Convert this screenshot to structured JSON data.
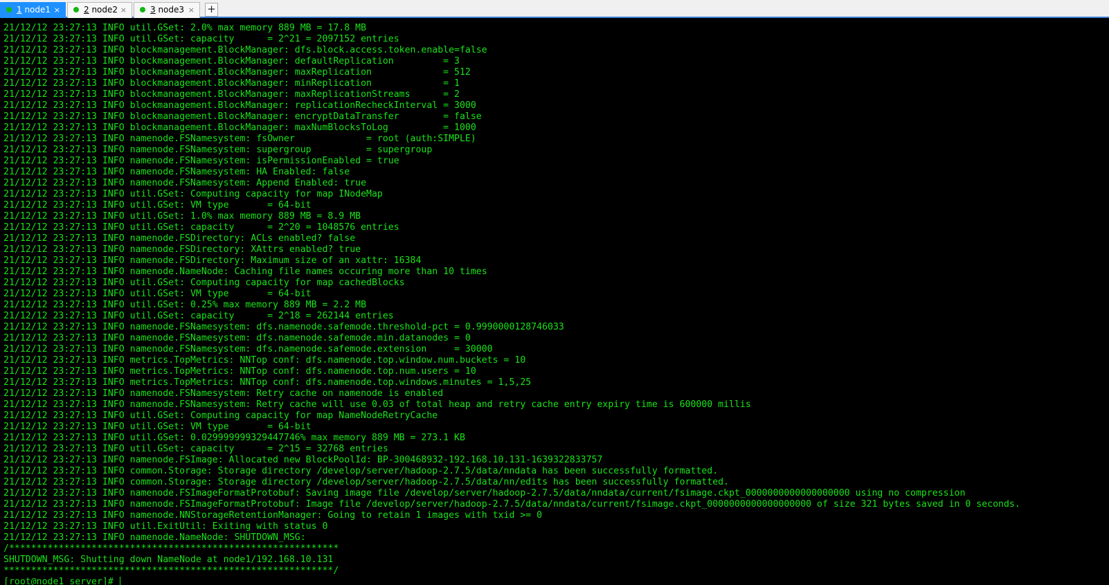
{
  "tabs": [
    {
      "num": "1",
      "label": " node1",
      "active": true
    },
    {
      "num": "2",
      "label": " node2",
      "active": false
    },
    {
      "num": "3",
      "label": " node3",
      "active": false
    }
  ],
  "add_tab_label": "+",
  "close_glyph": "×",
  "terminal": {
    "lines": [
      "21/12/12 23:27:13 INFO util.GSet: 2.0% max memory 889 MB = 17.8 MB",
      "21/12/12 23:27:13 INFO util.GSet: capacity      = 2^21 = 2097152 entries",
      "21/12/12 23:27:13 INFO blockmanagement.BlockManager: dfs.block.access.token.enable=false",
      "21/12/12 23:27:13 INFO blockmanagement.BlockManager: defaultReplication         = 3",
      "21/12/12 23:27:13 INFO blockmanagement.BlockManager: maxReplication             = 512",
      "21/12/12 23:27:13 INFO blockmanagement.BlockManager: minReplication             = 1",
      "21/12/12 23:27:13 INFO blockmanagement.BlockManager: maxReplicationStreams      = 2",
      "21/12/12 23:27:13 INFO blockmanagement.BlockManager: replicationRecheckInterval = 3000",
      "21/12/12 23:27:13 INFO blockmanagement.BlockManager: encryptDataTransfer        = false",
      "21/12/12 23:27:13 INFO blockmanagement.BlockManager: maxNumBlocksToLog          = 1000",
      "21/12/12 23:27:13 INFO namenode.FSNamesystem: fsOwner             = root (auth:SIMPLE)",
      "21/12/12 23:27:13 INFO namenode.FSNamesystem: supergroup          = supergroup",
      "21/12/12 23:27:13 INFO namenode.FSNamesystem: isPermissionEnabled = true",
      "21/12/12 23:27:13 INFO namenode.FSNamesystem: HA Enabled: false",
      "21/12/12 23:27:13 INFO namenode.FSNamesystem: Append Enabled: true",
      "21/12/12 23:27:13 INFO util.GSet: Computing capacity for map INodeMap",
      "21/12/12 23:27:13 INFO util.GSet: VM type       = 64-bit",
      "21/12/12 23:27:13 INFO util.GSet: 1.0% max memory 889 MB = 8.9 MB",
      "21/12/12 23:27:13 INFO util.GSet: capacity      = 2^20 = 1048576 entries",
      "21/12/12 23:27:13 INFO namenode.FSDirectory: ACLs enabled? false",
      "21/12/12 23:27:13 INFO namenode.FSDirectory: XAttrs enabled? true",
      "21/12/12 23:27:13 INFO namenode.FSDirectory: Maximum size of an xattr: 16384",
      "21/12/12 23:27:13 INFO namenode.NameNode: Caching file names occuring more than 10 times",
      "21/12/12 23:27:13 INFO util.GSet: Computing capacity for map cachedBlocks",
      "21/12/12 23:27:13 INFO util.GSet: VM type       = 64-bit",
      "21/12/12 23:27:13 INFO util.GSet: 0.25% max memory 889 MB = 2.2 MB",
      "21/12/12 23:27:13 INFO util.GSet: capacity      = 2^18 = 262144 entries",
      "21/12/12 23:27:13 INFO namenode.FSNamesystem: dfs.namenode.safemode.threshold-pct = 0.9990000128746033",
      "21/12/12 23:27:13 INFO namenode.FSNamesystem: dfs.namenode.safemode.min.datanodes = 0",
      "21/12/12 23:27:13 INFO namenode.FSNamesystem: dfs.namenode.safemode.extension     = 30000",
      "21/12/12 23:27:13 INFO metrics.TopMetrics: NNTop conf: dfs.namenode.top.window.num.buckets = 10",
      "21/12/12 23:27:13 INFO metrics.TopMetrics: NNTop conf: dfs.namenode.top.num.users = 10",
      "21/12/12 23:27:13 INFO metrics.TopMetrics: NNTop conf: dfs.namenode.top.windows.minutes = 1,5,25",
      "21/12/12 23:27:13 INFO namenode.FSNamesystem: Retry cache on namenode is enabled",
      "21/12/12 23:27:13 INFO namenode.FSNamesystem: Retry cache will use 0.03 of total heap and retry cache entry expiry time is 600000 millis",
      "21/12/12 23:27:13 INFO util.GSet: Computing capacity for map NameNodeRetryCache",
      "21/12/12 23:27:13 INFO util.GSet: VM type       = 64-bit",
      "21/12/12 23:27:13 INFO util.GSet: 0.029999999329447746% max memory 889 MB = 273.1 KB",
      "21/12/12 23:27:13 INFO util.GSet: capacity      = 2^15 = 32768 entries",
      "21/12/12 23:27:13 INFO namenode.FSImage: Allocated new BlockPoolId: BP-300468932-192.168.10.131-1639322833757",
      "21/12/12 23:27:13 INFO common.Storage: Storage directory /develop/server/hadoop-2.7.5/data/nndata has been successfully formatted.",
      "21/12/12 23:27:13 INFO common.Storage: Storage directory /develop/server/hadoop-2.7.5/data/nn/edits has been successfully formatted.",
      "21/12/12 23:27:13 INFO namenode.FSImageFormatProtobuf: Saving image file /develop/server/hadoop-2.7.5/data/nndata/current/fsimage.ckpt_0000000000000000000 using no compression",
      "21/12/12 23:27:13 INFO namenode.FSImageFormatProtobuf: Image file /develop/server/hadoop-2.7.5/data/nndata/current/fsimage.ckpt_0000000000000000000 of size 321 bytes saved in 0 seconds.",
      "21/12/12 23:27:13 INFO namenode.NNStorageRetentionManager: Going to retain 1 images with txid >= 0",
      "21/12/12 23:27:13 INFO util.ExitUtil: Exiting with status 0",
      "21/12/12 23:27:13 INFO namenode.NameNode: SHUTDOWN_MSG: ",
      "/************************************************************",
      "SHUTDOWN_MSG: Shutting down NameNode at node1/192.168.10.131",
      "************************************************************/"
    ],
    "prompt": "[root@node1 server]# "
  },
  "colors": {
    "terminal_bg": "#000000",
    "terminal_fg": "#19e219",
    "active_tab": "#1e90ff",
    "status_dot": "#11b711"
  }
}
